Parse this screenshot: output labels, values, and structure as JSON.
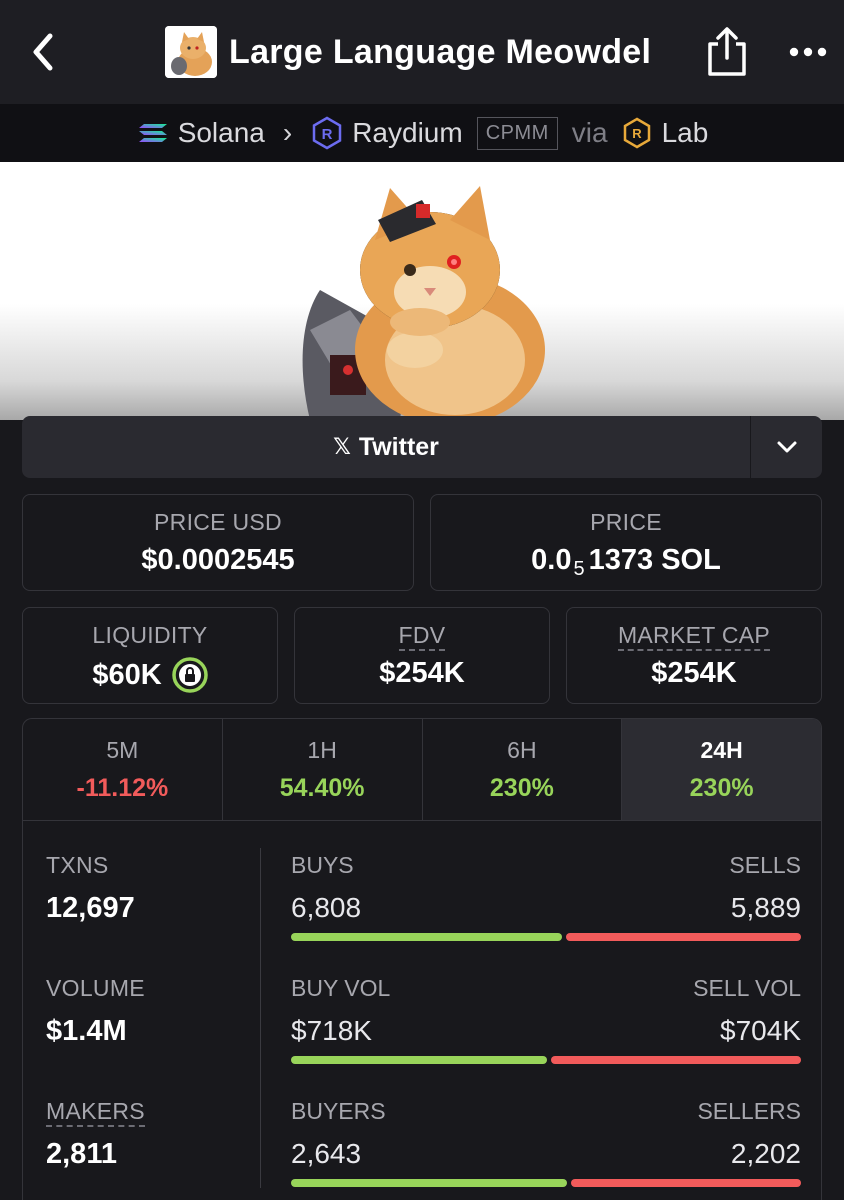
{
  "header": {
    "title": "Large Language Meowdel"
  },
  "breadcrumb": {
    "chain": "Solana",
    "dex": "Raydium",
    "pool_type": "CPMM",
    "via": "via",
    "launchpad": "Lab"
  },
  "links": {
    "twitter_label": "Twitter"
  },
  "prices": {
    "price_usd_label": "PRICE USD",
    "price_usd": "$0.0002545",
    "price_label": "PRICE",
    "price_prefix": "0.0",
    "price_zero_count": "5",
    "price_suffix": "1373 SOL"
  },
  "metrics": {
    "liquidity_label": "LIQUIDITY",
    "liquidity": "$60K",
    "fdv_label": "FDV",
    "fdv": "$254K",
    "mcap_label": "MARKET CAP",
    "mcap": "$254K"
  },
  "timeframes": [
    {
      "label": "5M",
      "change": "-11.12%",
      "direction": "down"
    },
    {
      "label": "1H",
      "change": "54.40%",
      "direction": "up"
    },
    {
      "label": "6H",
      "change": "230%",
      "direction": "up"
    },
    {
      "label": "24H",
      "change": "230%",
      "direction": "up",
      "active": true
    }
  ],
  "stats": {
    "txns_label": "TXNS",
    "txns": "12,697",
    "buys_label": "BUYS",
    "buys": "6,808",
    "sells_label": "SELLS",
    "sells": "5,889",
    "buys_share": 0.536,
    "volume_label": "VOLUME",
    "volume": "$1.4M",
    "buy_vol_label": "BUY VOL",
    "buy_vol": "$718K",
    "sell_vol_label": "SELL VOL",
    "sell_vol": "$704K",
    "buy_vol_share": 0.505,
    "makers_label": "MAKERS",
    "makers": "2,811",
    "buyers_label": "BUYERS",
    "buyers": "2,643",
    "sellers_label": "SELLERS",
    "sellers": "2,202",
    "buyers_share": 0.545
  },
  "colors": {
    "positive": "#98d45a",
    "negative": "#f25b5b",
    "background": "#18181c"
  }
}
